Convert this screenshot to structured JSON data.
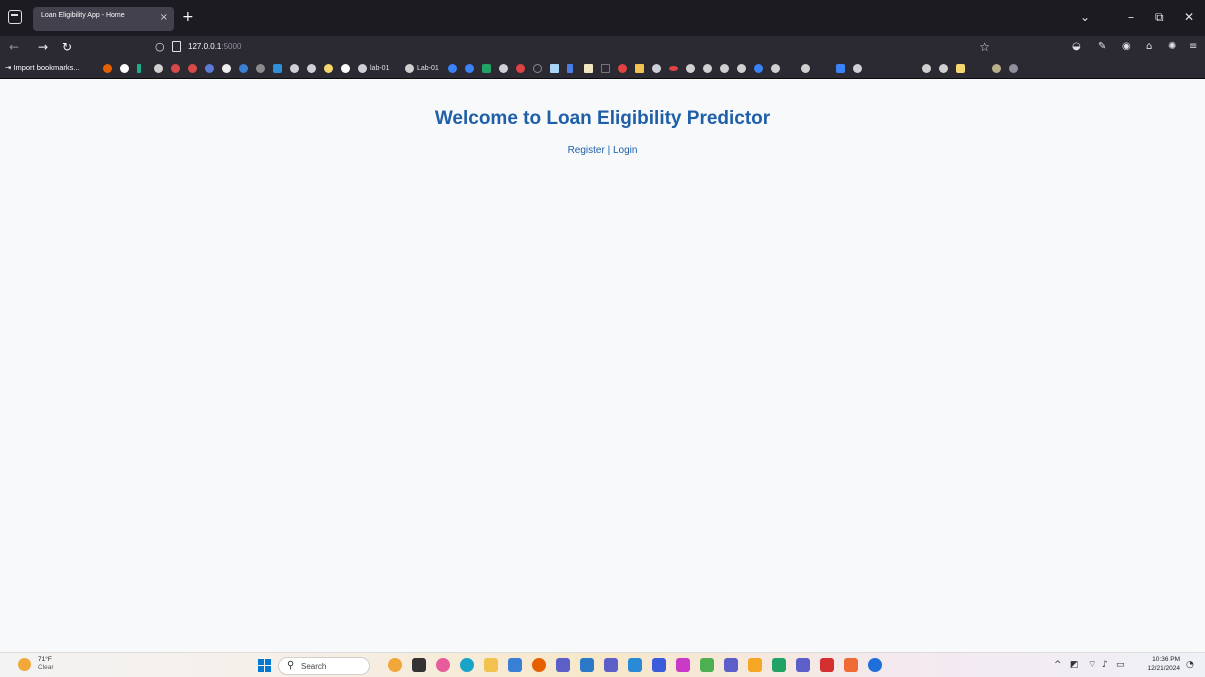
{
  "browser": {
    "tab_title": "Loan Eligibility App - Home",
    "tab_close": "×",
    "new_tab": "+",
    "url_host": "127.0.0.1",
    "url_port": ":5000",
    "bookmarks_import": "Import bookmarks...",
    "bookmark_lab_1": "lab-01",
    "bookmark_lab_2": "Lab-01"
  },
  "page": {
    "heading": "Welcome to Loan Eligibility Predictor",
    "register_link": "Register",
    "separator": " | ",
    "login_link": "Login"
  },
  "taskbar": {
    "weather_temp": "71°F",
    "weather_condition": "Clear",
    "search_placeholder": "Search",
    "time": "10:36 PM",
    "date": "12/21/2024"
  },
  "colors": {
    "heading": "#1e5fa8",
    "link": "#1e5fa8",
    "page_background": "#f8f9fa",
    "chrome_dark": "#1c1b22",
    "toolbar": "#2b2a33"
  }
}
